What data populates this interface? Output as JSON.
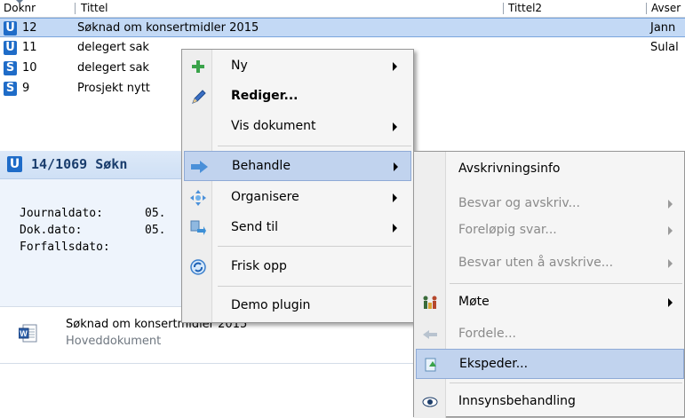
{
  "columns": {
    "doknr": "Doknr",
    "tittel": "Tittel",
    "tittel2": "Tittel2",
    "avsender": "Avser"
  },
  "rows": [
    {
      "type": "U",
      "no": "12",
      "title": "Søknad om konsertmidler 2015",
      "sender": "Jann"
    },
    {
      "type": "U",
      "no": "11",
      "title": "delegert sak",
      "sender": "Sulal"
    },
    {
      "type": "S",
      "no": "10",
      "title": "delegert sak",
      "sender": ""
    },
    {
      "type": "S",
      "no": "9",
      "title": "Prosjekt nytt",
      "sender": ""
    }
  ],
  "detail": {
    "badge": "U",
    "title": "14/1069 Søkn",
    "journaldato_label": "Journaldato:",
    "journaldato_value": "05.",
    "dokdato_label": "Dok.dato:",
    "dokdato_value": "05.",
    "forfallsdato_label": "Forfallsdato:"
  },
  "attachment": {
    "title": "Søknad om konsertmidler 2015",
    "subtitle": "Hoveddokument"
  },
  "context_menu": {
    "items": [
      {
        "label": "Ny",
        "icon": "plus-icon",
        "submenu": true
      },
      {
        "label": "Rediger...",
        "icon": "pencil-icon",
        "submenu": false,
        "bold": true
      },
      {
        "label": "Vis dokument",
        "icon": "",
        "submenu": true
      },
      {
        "label": "Behandle",
        "icon": "process-arrow-icon",
        "submenu": true,
        "highlighted": true
      },
      {
        "label": "Organisere",
        "icon": "organize-icon",
        "submenu": true
      },
      {
        "label": "Send til",
        "icon": "send-to-icon",
        "submenu": true
      },
      {
        "label": "Frisk opp",
        "icon": "refresh-icon",
        "submenu": false
      },
      {
        "label": "Demo plugin",
        "icon": "",
        "submenu": false
      }
    ]
  },
  "sub_menu": {
    "items": [
      {
        "label": "Avskrivningsinfo",
        "submenu": false,
        "disabled": false
      },
      {
        "label": "Besvar og avskriv...",
        "submenu": true,
        "disabled": true
      },
      {
        "label": "Foreløpig svar...",
        "submenu": true,
        "disabled": true
      },
      {
        "label": "Besvar uten å avskrive...",
        "submenu": true,
        "disabled": true
      },
      {
        "label": "Møte",
        "icon": "meeting-icon",
        "submenu": true,
        "disabled": false
      },
      {
        "label": "Fordele...",
        "icon": "distribute-icon",
        "submenu": false,
        "disabled": true
      },
      {
        "label": "Ekspeder...",
        "icon": "dispatch-icon",
        "submenu": false,
        "disabled": false,
        "highlighted": true
      },
      {
        "label": "Innsynsbehandling",
        "icon": "eye-icon",
        "submenu": false,
        "disabled": false
      }
    ]
  },
  "colors": {
    "selected_row": "#c3d9f5",
    "badge_blue": "#1f6cc8",
    "menu_highlight": "#c1d3ee"
  }
}
